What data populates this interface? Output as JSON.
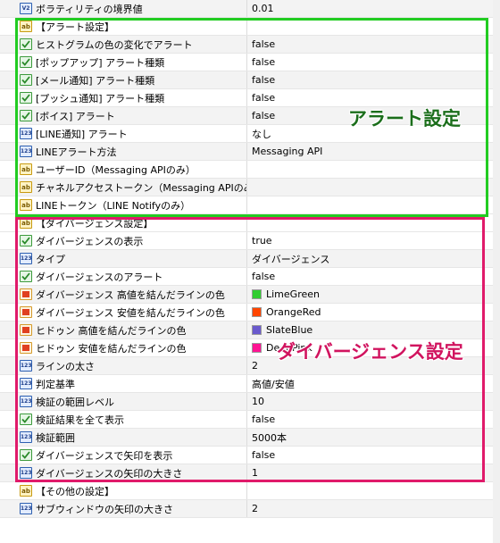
{
  "rows": [
    {
      "kind": "param",
      "icon": "v2",
      "name": "ボラティリティの境界値",
      "value": "0.01"
    },
    {
      "kind": "section",
      "icon": "ab",
      "name": "【アラート設定】",
      "value": ""
    },
    {
      "kind": "param",
      "icon": "chk",
      "name": "ヒストグラムの色の変化でアラート",
      "value": "false"
    },
    {
      "kind": "param",
      "icon": "chk",
      "name": "[ポップアップ] アラート種類",
      "value": "false"
    },
    {
      "kind": "param",
      "icon": "chk",
      "name": "[メール通知] アラート種類",
      "value": "false"
    },
    {
      "kind": "param",
      "icon": "chk",
      "name": "[プッシュ通知] アラート種類",
      "value": "false"
    },
    {
      "kind": "param",
      "icon": "chk",
      "name": "[ボイス] アラート",
      "value": "false"
    },
    {
      "kind": "param",
      "icon": "123",
      "name": "[LINE通知] アラート",
      "value": "なし"
    },
    {
      "kind": "param",
      "icon": "123",
      "name": "LINEアラート方法",
      "value": "Messaging API"
    },
    {
      "kind": "param",
      "icon": "ab",
      "name": "ユーザーID（Messaging APIのみ）",
      "value": ""
    },
    {
      "kind": "param",
      "icon": "ab",
      "name": "チャネルアクセストークン（Messaging APIのみ）",
      "value": ""
    },
    {
      "kind": "param",
      "icon": "ab",
      "name": "LINEトークン（LINE Notifyのみ）",
      "value": ""
    },
    {
      "kind": "section",
      "icon": "ab",
      "name": "【ダイバージェンス設定】",
      "value": ""
    },
    {
      "kind": "param",
      "icon": "chk",
      "name": "ダイバージェンスの表示",
      "value": "true"
    },
    {
      "kind": "param",
      "icon": "123",
      "name": "タイプ",
      "value": "ダイバージェンス"
    },
    {
      "kind": "param",
      "icon": "chk",
      "name": "ダイバージェンスのアラート",
      "value": "false"
    },
    {
      "kind": "param",
      "icon": "col",
      "name": "ダイバージェンス 高値を結んだラインの色",
      "value": "LimeGreen",
      "color": "#32cd32"
    },
    {
      "kind": "param",
      "icon": "col",
      "name": "ダイバージェンス 安値を結んだラインの色",
      "value": "OrangeRed",
      "color": "#ff4500"
    },
    {
      "kind": "param",
      "icon": "col",
      "name": "ヒドゥン 高値を結んだラインの色",
      "value": "SlateBlue",
      "color": "#6a5acd"
    },
    {
      "kind": "param",
      "icon": "col",
      "name": "ヒドゥン 安値を結んだラインの色",
      "value": "DeepPink",
      "color": "#ff1493"
    },
    {
      "kind": "param",
      "icon": "123",
      "name": "ラインの太さ",
      "value": "2"
    },
    {
      "kind": "param",
      "icon": "123",
      "name": "判定基準",
      "value": "高値/安値"
    },
    {
      "kind": "param",
      "icon": "123",
      "name": "検証の範囲レベル",
      "value": "10"
    },
    {
      "kind": "param",
      "icon": "chk",
      "name": "検証結果を全て表示",
      "value": "false"
    },
    {
      "kind": "param",
      "icon": "123",
      "name": "検証範囲",
      "value": "5000本"
    },
    {
      "kind": "param",
      "icon": "chk",
      "name": "ダイバージェンスで矢印を表示",
      "value": "false"
    },
    {
      "kind": "param",
      "icon": "123",
      "name": "ダイバージェンスの矢印の大きさ",
      "value": "1"
    },
    {
      "kind": "section",
      "icon": "ab",
      "name": "【その他の設定】",
      "value": ""
    },
    {
      "kind": "param",
      "icon": "123",
      "name": "サブウィンドウの矢印の大きさ",
      "value": "2"
    }
  ],
  "annotations": {
    "alert": "アラート設定",
    "divergence": "ダイバージェンス設定"
  },
  "colors": {
    "alert_box": "#22cc22",
    "divergence_box": "#e01a6a"
  }
}
